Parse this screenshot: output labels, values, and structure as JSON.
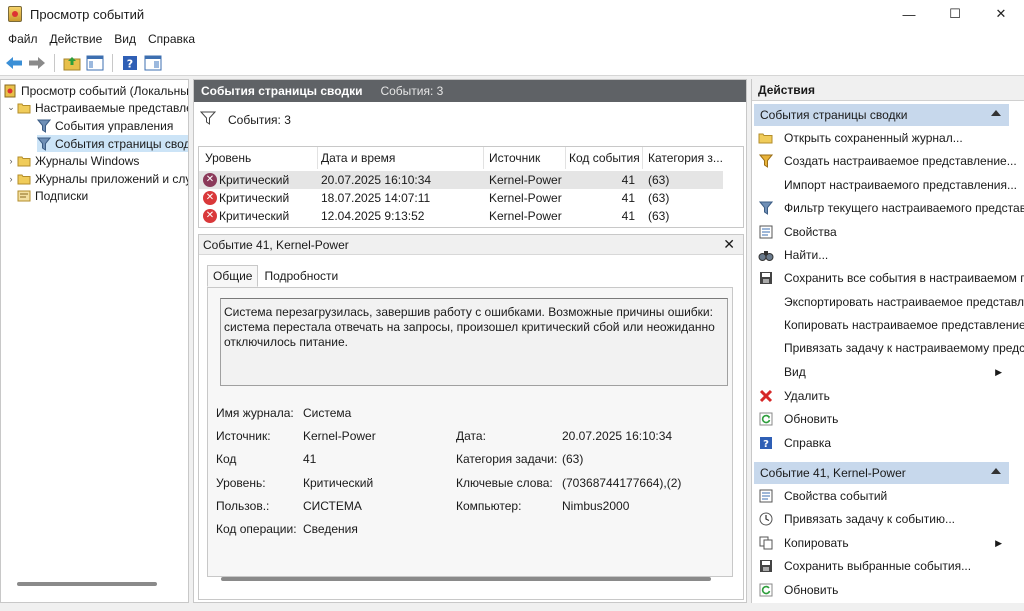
{
  "window": {
    "title": "Просмотр событий",
    "minimize": "—",
    "maximize": "☐",
    "close": "✕"
  },
  "menu": [
    "Файл",
    "Действие",
    "Вид",
    "Справка"
  ],
  "tree": {
    "root": "Просмотр событий (Локальный)",
    "custom_views": "Настраиваемые представления",
    "admin_events": "События управления",
    "summary_events": "События страницы сводки",
    "windows_logs": "Журналы Windows",
    "app_logs": "Журналы приложений и служб",
    "subscriptions": "Подписки"
  },
  "main": {
    "header_title": "События страницы сводки",
    "header_count": "События: 3",
    "filter_label": "События: 3",
    "columns": [
      "Уровень",
      "Дата и время",
      "Источник",
      "Код события",
      "Категория з..."
    ],
    "rows": [
      {
        "level": "Критический",
        "datetime": "20.07.2025 16:10:34",
        "source": "Kernel-Power",
        "code": "41",
        "category": "(63)"
      },
      {
        "level": "Критический",
        "datetime": "18.07.2025 14:07:11",
        "source": "Kernel-Power",
        "code": "41",
        "category": "(63)"
      },
      {
        "level": "Критический",
        "datetime": "12.04.2025 9:13:52",
        "source": "Kernel-Power",
        "code": "41",
        "category": "(63)"
      }
    ]
  },
  "detail": {
    "title": "Событие 41, Kernel-Power",
    "close": "✕",
    "tabs": [
      "Общие",
      "Подробности"
    ],
    "description": "Система перезагрузилась, завершив работу с ошибками. Возможные причины ошибки: система перестала отвечать на запросы, произошел критический сбой или неожиданно отключилось питание.",
    "labels": {
      "log_name": "Имя журнала:",
      "source": "Источник:",
      "code": "Код",
      "level": "Уровень:",
      "user": "Пользов.:",
      "opcode": "Код операции:",
      "date": "Дата:",
      "task_category": "Категория задачи:",
      "keywords": "Ключевые слова:",
      "computer": "Компьютер:"
    },
    "values": {
      "log_name": "Система",
      "source": "Kernel-Power",
      "code": "41",
      "level": "Критический",
      "user": "СИСТЕМА",
      "opcode": "Сведения",
      "date": "20.07.2025 16:10:34",
      "task_category": "(63)",
      "keywords": "(70368744177664),(2)",
      "computer": "Nimbus2000"
    }
  },
  "actions": {
    "title": "Действия",
    "section1": "События страницы сводки",
    "items1": [
      "Открыть сохраненный журнал...",
      "Создать настраиваемое представление...",
      "Импорт настраиваемого представления...",
      "Фильтр текущего настраиваемого представления...",
      "Свойства",
      "Найти...",
      "Сохранить все события в настраиваемом представлении как...",
      "Экспортировать настраиваемое представление...",
      "Копировать настраиваемое представление...",
      "Привязать задачу к настраиваемому представлению...",
      "Вид",
      "Удалить",
      "Обновить",
      "Справка"
    ],
    "section2": "Событие 41, Kernel-Power",
    "items2": [
      "Свойства событий",
      "Привязать задачу к событию...",
      "Копировать",
      "Сохранить выбранные события...",
      "Обновить"
    ]
  }
}
